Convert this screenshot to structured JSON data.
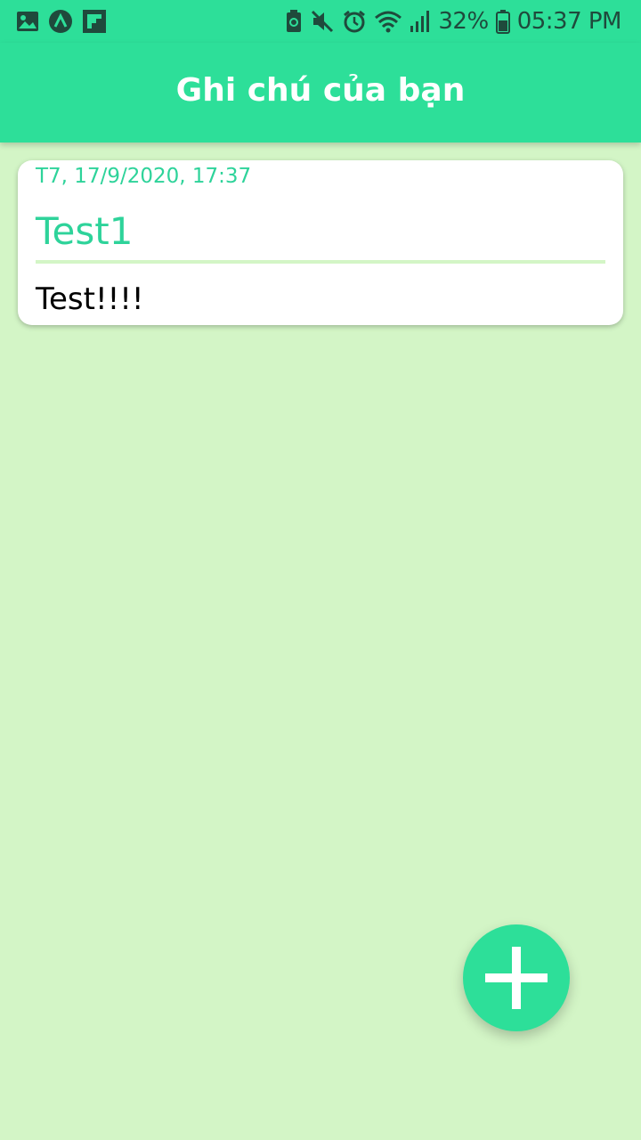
{
  "status_bar": {
    "left_icons": [
      "gallery-icon",
      "app-a-icon",
      "flipboard-icon"
    ],
    "right_icons": [
      "battery-saver-icon",
      "mute-icon",
      "alarm-icon",
      "wifi-icon",
      "signal-icon",
      "battery-icon"
    ],
    "battery_percent": "32%",
    "time": "05:37 PM"
  },
  "app_bar": {
    "title": "Ghi chú của bạn"
  },
  "notes": [
    {
      "date": "T7, 17/9/2020, 17:37",
      "title": "Test1",
      "body": "Test!!!!"
    }
  ],
  "fab": {
    "icon": "plus-icon"
  },
  "colors": {
    "primary": "#2ddf99",
    "background": "#d3f5c6",
    "accent_text": "#2ed39a",
    "card": "#ffffff"
  }
}
